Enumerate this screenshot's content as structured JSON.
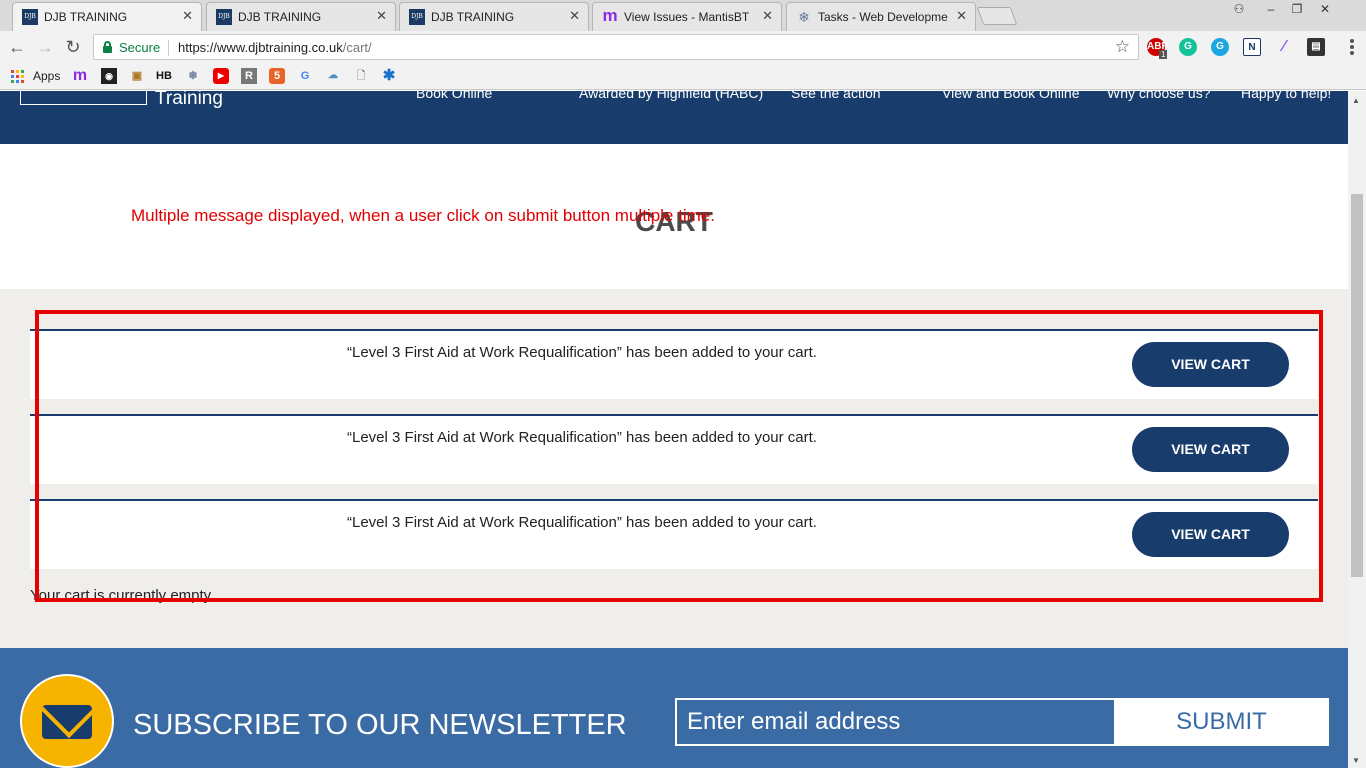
{
  "browser": {
    "tabs": [
      {
        "title": "DJB TRAINING",
        "icon": "djb-favicon",
        "active": true
      },
      {
        "title": "DJB TRAINING",
        "icon": "djb-favicon",
        "active": false
      },
      {
        "title": "DJB TRAINING",
        "icon": "djb-favicon",
        "active": false
      },
      {
        "title": "View Issues - MantisBT",
        "icon": "mantis-favicon",
        "active": false
      },
      {
        "title": "Tasks - Web Developmen",
        "icon": "tasks-favicon",
        "active": false
      }
    ],
    "secure_label": "Secure",
    "url_host": "https://www.djbtraining.co.uk",
    "url_path": "/cart/",
    "bookmarks_apps_label": "Apps",
    "abp_badge": "1"
  },
  "header": {
    "logo_text": "Training",
    "nav": [
      "Book Online",
      "Awarded by Highfield (HABC)",
      "See the action",
      "View and Book Online",
      "Why choose us?",
      "Happy to help!"
    ]
  },
  "page": {
    "title": "CART",
    "annotation": "Multiple message displayed, when a user click on submit button multiple time."
  },
  "cart": {
    "notices": [
      {
        "message": "“Level 3 First Aid at Work Requalification” has been added to your cart.",
        "button": "VIEW CART"
      },
      {
        "message": "“Level 3 First Aid at Work Requalification” has been added to your cart.",
        "button": "VIEW CART"
      },
      {
        "message": "“Level 3 First Aid at Work Requalification” has been added to your cart.",
        "button": "VIEW CART"
      }
    ],
    "empty_message": "Your cart is currently empty."
  },
  "newsletter": {
    "title": "SUBSCRIBE TO OUR NEWSLETTER",
    "email_placeholder": "Enter email address",
    "submit_label": "SUBMIT"
  },
  "colors": {
    "brand_navy": "#183c6c",
    "newsletter_blue": "#3a6ba5",
    "accent_yellow": "#f6b400",
    "annotation_red": "#e60000"
  }
}
